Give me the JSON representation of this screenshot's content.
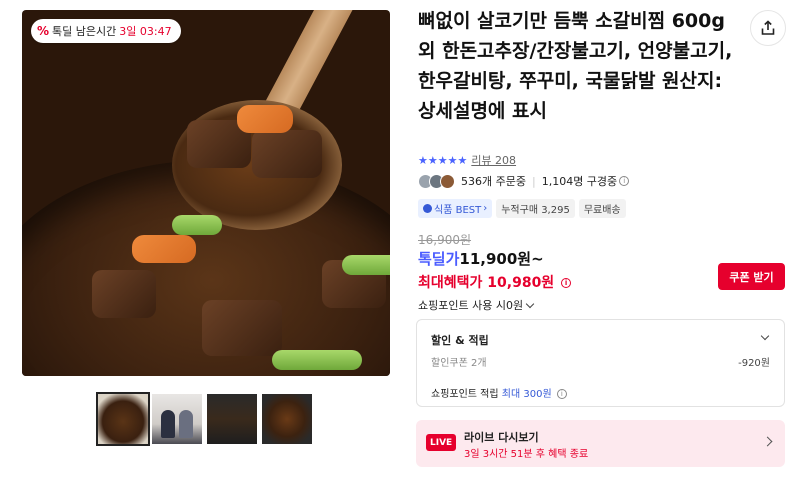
{
  "deal_badge": {
    "label": "톡딜 남은시간",
    "timer": "3일 03:47"
  },
  "thumbnails": [
    {
      "name": "thumb-galbijjim"
    },
    {
      "name": "thumb-people"
    },
    {
      "name": "thumb-bulgogi"
    },
    {
      "name": "thumb-stew"
    }
  ],
  "product": {
    "title": "뼈없이 살코기만 듬뿍 소갈비찜 600g 외 한돈고추장/간장불고기, 언양불고기, 한우갈비탕, 쭈꾸미, 국물닭발 원산지: 상세설명에 표시",
    "stars": "★★★★★",
    "review_label": "리뷰 208",
    "order_count": "536개 주문중",
    "viewer_count": "1,104명 구경중",
    "tags": {
      "best": "식품 BEST",
      "cumulative": "누적구매 3,295",
      "shipping": "무료배송"
    }
  },
  "pricing": {
    "original": "16,900원",
    "deal_label": "톡딜가",
    "deal_price": "11,900원~",
    "max_label": "최대혜택가",
    "max_price": "10,980원",
    "coupon_button": "쿠폰 받기",
    "points_use": "쇼핑포인트 사용 시0원"
  },
  "discount_box": {
    "header": "할인 & 적립",
    "coupon_label": "할인쿠폰 2개",
    "coupon_value": "-920원",
    "points_label": "쇼핑포인트 적립",
    "points_value": "최대 300원"
  },
  "live": {
    "badge": "LIVE",
    "title": "라이브 다시보기",
    "subtitle": "3일 3시간 51분 후 혜택 종료"
  },
  "colors": {
    "accent_red": "#e6002d",
    "accent_blue": "#3559d6",
    "live_bg": "#fde9ee"
  },
  "icons": {
    "share": "share-icon",
    "info": "info-icon",
    "chevron": "chevron-down-icon",
    "percent": "percent-icon"
  }
}
